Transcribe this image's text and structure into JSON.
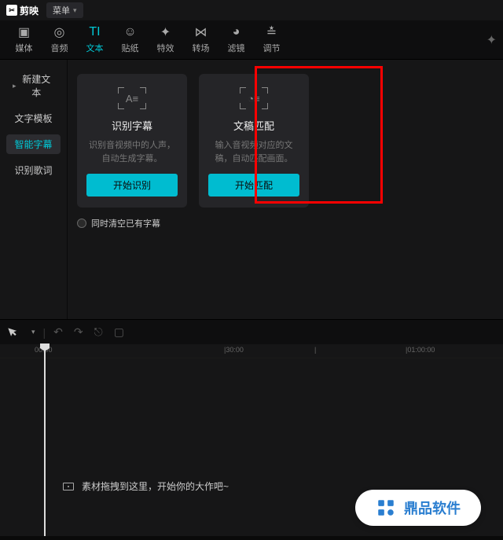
{
  "titlebar": {
    "app_name": "剪映",
    "menu_label": "菜单"
  },
  "toolbar": {
    "items": [
      {
        "label": "媒体"
      },
      {
        "label": "音频"
      },
      {
        "label": "文本"
      },
      {
        "label": "贴纸"
      },
      {
        "label": "特效"
      },
      {
        "label": "转场"
      },
      {
        "label": "滤镜"
      },
      {
        "label": "调节"
      }
    ]
  },
  "sidebar": {
    "items": [
      {
        "label": "新建文本"
      },
      {
        "label": "文字模板"
      },
      {
        "label": "智能字幕"
      },
      {
        "label": "识别歌词"
      }
    ]
  },
  "cards": [
    {
      "title": "识别字幕",
      "desc": "识别音视频中的人声，自动生成字幕。",
      "button": "开始识别"
    },
    {
      "title": "文稿匹配",
      "desc": "输入音视频对应的文稿，自动匹配画面。",
      "button": "开始匹配"
    }
  ],
  "checkbox_label": "同时清空已有字幕",
  "timeline": {
    "ticks": [
      "00:00",
      "|30:00",
      "|",
      "|01:00:00"
    ],
    "empty_msg": "素材拖拽到这里，开始你的大作吧~"
  },
  "watermark": {
    "text": "鼎品软件"
  }
}
